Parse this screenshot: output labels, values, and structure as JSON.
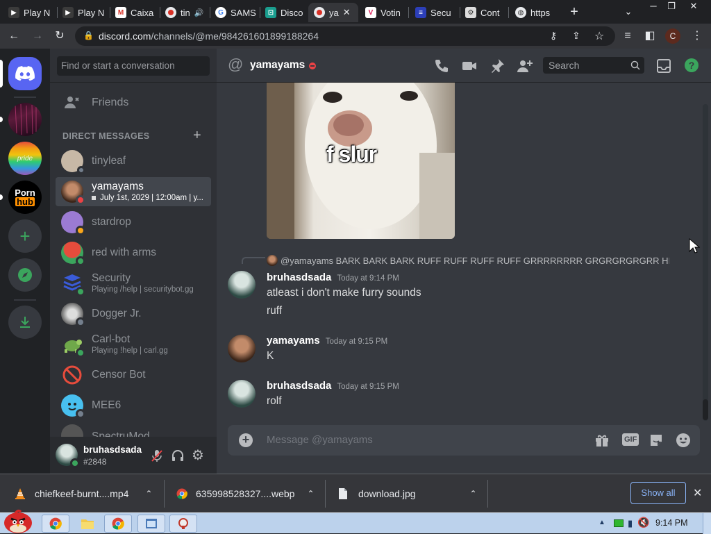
{
  "browser": {
    "tabs": [
      {
        "title": "Play N",
        "favicon": "play-icon"
      },
      {
        "title": "Play N",
        "favicon": "play-icon"
      },
      {
        "title": "Caixa",
        "favicon": "gmail-icon"
      },
      {
        "title": "tin",
        "favicon": "recording-icon"
      },
      {
        "title": "SAMS",
        "favicon": "google-icon"
      },
      {
        "title": "Disco",
        "favicon": "discord-icon"
      },
      {
        "title": "ya",
        "favicon": "recording-icon"
      },
      {
        "title": "Votin",
        "favicon": "voting-icon"
      },
      {
        "title": "Secu",
        "favicon": "shield-icon"
      },
      {
        "title": "Cont",
        "favicon": "contact-icon"
      },
      {
        "title": "https",
        "favicon": "globe-icon"
      }
    ],
    "new_tab": "+",
    "url_domain": "discord.com",
    "url_path": "/channels/@me/984261601899188264",
    "profile_initial": "C"
  },
  "guilds": {
    "add_server": "+",
    "explore": "compass-icon",
    "download": "download-icon",
    "server3_line1": "Porn",
    "server3_line2": "hub"
  },
  "sidebar": {
    "search_placeholder": "Find or start a conversation",
    "friends_label": "Friends",
    "dm_header": "DIRECT MESSAGES",
    "dm_add": "+",
    "dms": [
      {
        "name": "tinyleaf",
        "sub": "",
        "status": "offline",
        "color": "#c7b8a6"
      },
      {
        "name": "yamayams",
        "sub": "July 1st, 2029 | 12:00am | y...",
        "status": "dnd",
        "color": "#5a3b2a"
      },
      {
        "name": "stardrop",
        "sub": "",
        "status": "idle",
        "color": "#9b7bd3"
      },
      {
        "name": "red with arms",
        "sub": "",
        "status": "online",
        "color": "#d64a3b"
      },
      {
        "name": "Security",
        "sub": "Playing /help | securitybot.gg",
        "status": "online",
        "color": "#3a5bd9"
      },
      {
        "name": "Dogger Jr.",
        "sub": "",
        "status": "offline",
        "color": "#8a8a8a"
      },
      {
        "name": "Carl-bot",
        "sub": "Playing !help | carl.gg",
        "status": "online",
        "color": "#6fa84a"
      },
      {
        "name": "Censor Bot",
        "sub": "",
        "status": "none",
        "color": "#e74c3c"
      },
      {
        "name": "MEE6",
        "sub": "",
        "status": "offline",
        "color": "#48c0f0"
      },
      {
        "name": "SpectruMod",
        "sub": "",
        "status": "offline",
        "color": "#444"
      }
    ],
    "user": {
      "name": "bruhasdsada",
      "tag": "#2848"
    }
  },
  "chat": {
    "recipient": "yamayams",
    "search_placeholder": "Search",
    "image_caption": "f slur",
    "reply_preview": "@yamayams BARK BARK BARK RUFF RUFF RUFF RUFF GRRRRRRRR GRGRGRGRGRR HISSSS...",
    "messages": [
      {
        "author": "bruhasdsada",
        "time": "Today at 9:14 PM",
        "lines": [
          "atleast i don't make furry sounds",
          "ruff"
        ]
      },
      {
        "author": "yamayams",
        "time": "Today at 9:15 PM",
        "lines": [
          "K"
        ]
      },
      {
        "author": "bruhasdsada",
        "time": "Today at 9:15 PM",
        "lines": [
          "rolf"
        ]
      }
    ],
    "composer_placeholder": "Message @yamayams",
    "gif_label": "GIF"
  },
  "downloads": {
    "items": [
      "chiefkeef-burnt....mp4",
      "635998528327....webp",
      "download.jpg"
    ],
    "show_all": "Show all"
  },
  "taskbar": {
    "clock": "9:14 PM"
  }
}
